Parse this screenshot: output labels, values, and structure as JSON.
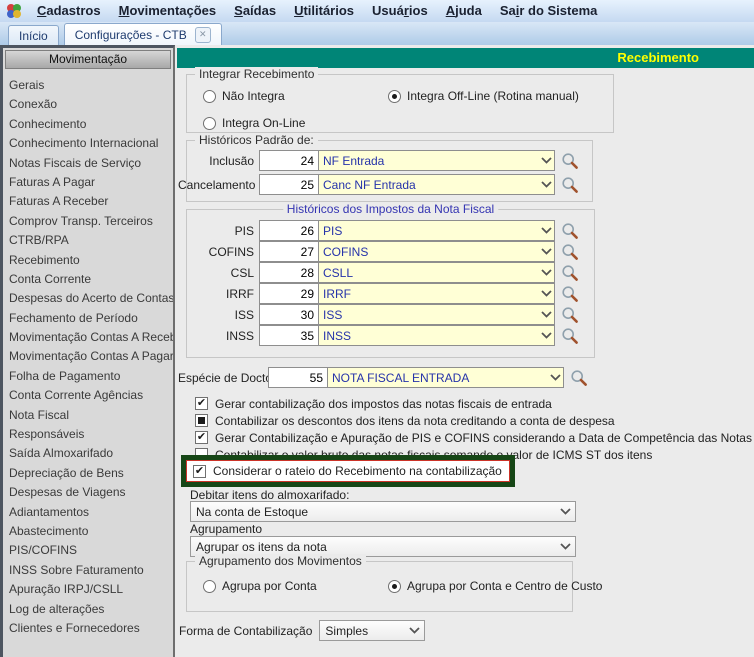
{
  "colors": {
    "header_bg": "#008577",
    "header_text": "#ffff00",
    "highlight_box": "#164616",
    "highlight_inner": "#cc3328",
    "combo_bg": "#ffffd6",
    "combo_text": "#2633aa",
    "impostos_legend": "#3434b2"
  },
  "menubar": {
    "items": [
      {
        "label": "Cadastros",
        "accel": 0
      },
      {
        "label": "Movimentações",
        "accel": 0
      },
      {
        "label": "Saídas",
        "accel": 0
      },
      {
        "label": "Utilitários",
        "accel": 0
      },
      {
        "label": "Usuários",
        "accel": 4
      },
      {
        "label": "Ajuda",
        "accel": 0
      },
      {
        "label": "Sair do Sistema",
        "accel": 2
      }
    ]
  },
  "tabs": [
    {
      "label": "Início",
      "active": false,
      "closable": false
    },
    {
      "label": "Configurações - CTB",
      "active": true,
      "closable": true
    }
  ],
  "sidebar": {
    "title": "Movimentação",
    "items": [
      "Gerais",
      "Conexão",
      "Conhecimento",
      "Conhecimento Internacional",
      "Notas Fiscais de Serviço",
      "Faturas A Pagar",
      "Faturas A Receber",
      "Comprov Transp. Terceiros",
      "CTRB/RPA",
      "Recebimento",
      "Conta Corrente",
      "Despesas do Acerto de Contas",
      "Fechamento de Período",
      "Movimentação Contas A Receber",
      "Movimentação Contas A Pagar",
      "Folha de Pagamento",
      "Conta Corrente Agências",
      "Nota Fiscal",
      "Responsáveis",
      "Saída Almoxarifado",
      "Depreciação de Bens",
      "Despesas de Viagens",
      "Adiantamentos",
      "Abastecimento",
      "PIS/COFINS",
      "INSS Sobre Faturamento",
      "Apuração IRPJ/CSLL",
      "Log de alterações",
      "Clientes e Fornecedores"
    ]
  },
  "panel": {
    "title": "Recebimento",
    "integrar": {
      "legend": "Integrar Recebimento",
      "options": [
        {
          "label": "Não Integra",
          "selected": false
        },
        {
          "label": "Integra Off-Line (Rotina manual)",
          "selected": true
        },
        {
          "label": "Integra On-Line",
          "selected": false
        }
      ]
    },
    "historicos_padrao": {
      "legend": "Históricos Padrão de:",
      "rows": [
        {
          "label": "Inclusão",
          "code": "24",
          "value": "NF Entrada"
        },
        {
          "label": "Cancelamento",
          "code": "25",
          "value": "Canc NF Entrada"
        }
      ]
    },
    "historicos_impostos": {
      "legend": "Históricos dos Impostos da Nota Fiscal",
      "rows": [
        {
          "label": "PIS",
          "code": "26",
          "value": "PIS"
        },
        {
          "label": "COFINS",
          "code": "27",
          "value": "COFINS"
        },
        {
          "label": "CSL",
          "code": "28",
          "value": "CSLL"
        },
        {
          "label": "IRRF",
          "code": "29",
          "value": "IRRF"
        },
        {
          "label": "ISS",
          "code": "30",
          "value": "ISS"
        },
        {
          "label": "INSS",
          "code": "35",
          "value": "INSS"
        }
      ]
    },
    "especie": {
      "label": "Espécie de Docto.",
      "code": "55",
      "value": "NOTA FISCAL ENTRADA"
    },
    "checkboxes": [
      {
        "label": "Gerar contabilização dos impostos das notas fiscais de entrada",
        "state": "checked",
        "highlighted": false
      },
      {
        "label": "Contabilizar os descontos dos itens da nota creditando a conta de despesa",
        "state": "indeterminate",
        "highlighted": false
      },
      {
        "label": "Gerar Contabilização e Apuração de PIS e COFINS considerando a Data de Competência das Notas Fiscais",
        "state": "checked",
        "highlighted": false
      },
      {
        "label": "Contabilizar o valor bruto das notas fiscais somando o valor de ICMS ST dos itens",
        "state": "unchecked",
        "highlighted": false
      },
      {
        "label": "Considerar o rateio do Recebimento na contabilização",
        "state": "checked",
        "highlighted": true
      }
    ],
    "debitar": {
      "label": "Debitar itens do almoxarifado:",
      "value": "Na conta de Estoque"
    },
    "agrupamento": {
      "label": "Agrupamento",
      "value": "Agrupar os itens da nota"
    },
    "agrup_movimentos": {
      "legend": "Agrupamento dos Movimentos",
      "options": [
        {
          "label": "Agrupa por Conta",
          "selected": false
        },
        {
          "label": "Agrupa por Conta e Centro de Custo",
          "selected": true
        }
      ]
    },
    "forma": {
      "label": "Forma de Contabilização",
      "value": "Simples"
    }
  }
}
